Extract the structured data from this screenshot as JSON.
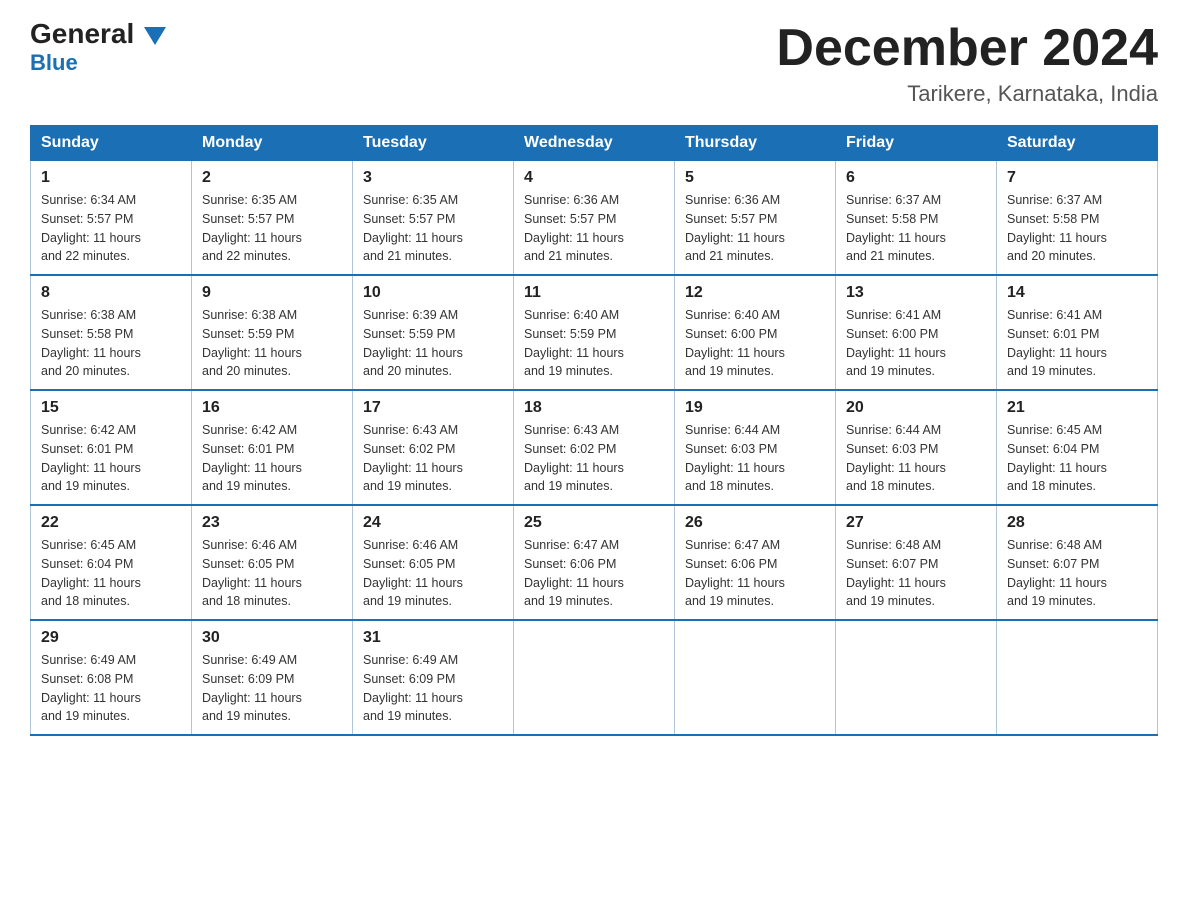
{
  "header": {
    "logo_general": "General",
    "logo_blue": "Blue",
    "month_title": "December 2024",
    "location": "Tarikere, Karnataka, India"
  },
  "days_of_week": [
    "Sunday",
    "Monday",
    "Tuesday",
    "Wednesday",
    "Thursday",
    "Friday",
    "Saturday"
  ],
  "weeks": [
    [
      {
        "day": "1",
        "sunrise": "6:34 AM",
        "sunset": "5:57 PM",
        "daylight": "11 hours and 22 minutes."
      },
      {
        "day": "2",
        "sunrise": "6:35 AM",
        "sunset": "5:57 PM",
        "daylight": "11 hours and 22 minutes."
      },
      {
        "day": "3",
        "sunrise": "6:35 AM",
        "sunset": "5:57 PM",
        "daylight": "11 hours and 21 minutes."
      },
      {
        "day": "4",
        "sunrise": "6:36 AM",
        "sunset": "5:57 PM",
        "daylight": "11 hours and 21 minutes."
      },
      {
        "day": "5",
        "sunrise": "6:36 AM",
        "sunset": "5:57 PM",
        "daylight": "11 hours and 21 minutes."
      },
      {
        "day": "6",
        "sunrise": "6:37 AM",
        "sunset": "5:58 PM",
        "daylight": "11 hours and 21 minutes."
      },
      {
        "day": "7",
        "sunrise": "6:37 AM",
        "sunset": "5:58 PM",
        "daylight": "11 hours and 20 minutes."
      }
    ],
    [
      {
        "day": "8",
        "sunrise": "6:38 AM",
        "sunset": "5:58 PM",
        "daylight": "11 hours and 20 minutes."
      },
      {
        "day": "9",
        "sunrise": "6:38 AM",
        "sunset": "5:59 PM",
        "daylight": "11 hours and 20 minutes."
      },
      {
        "day": "10",
        "sunrise": "6:39 AM",
        "sunset": "5:59 PM",
        "daylight": "11 hours and 20 minutes."
      },
      {
        "day": "11",
        "sunrise": "6:40 AM",
        "sunset": "5:59 PM",
        "daylight": "11 hours and 19 minutes."
      },
      {
        "day": "12",
        "sunrise": "6:40 AM",
        "sunset": "6:00 PM",
        "daylight": "11 hours and 19 minutes."
      },
      {
        "day": "13",
        "sunrise": "6:41 AM",
        "sunset": "6:00 PM",
        "daylight": "11 hours and 19 minutes."
      },
      {
        "day": "14",
        "sunrise": "6:41 AM",
        "sunset": "6:01 PM",
        "daylight": "11 hours and 19 minutes."
      }
    ],
    [
      {
        "day": "15",
        "sunrise": "6:42 AM",
        "sunset": "6:01 PM",
        "daylight": "11 hours and 19 minutes."
      },
      {
        "day": "16",
        "sunrise": "6:42 AM",
        "sunset": "6:01 PM",
        "daylight": "11 hours and 19 minutes."
      },
      {
        "day": "17",
        "sunrise": "6:43 AM",
        "sunset": "6:02 PM",
        "daylight": "11 hours and 19 minutes."
      },
      {
        "day": "18",
        "sunrise": "6:43 AM",
        "sunset": "6:02 PM",
        "daylight": "11 hours and 19 minutes."
      },
      {
        "day": "19",
        "sunrise": "6:44 AM",
        "sunset": "6:03 PM",
        "daylight": "11 hours and 18 minutes."
      },
      {
        "day": "20",
        "sunrise": "6:44 AM",
        "sunset": "6:03 PM",
        "daylight": "11 hours and 18 minutes."
      },
      {
        "day": "21",
        "sunrise": "6:45 AM",
        "sunset": "6:04 PM",
        "daylight": "11 hours and 18 minutes."
      }
    ],
    [
      {
        "day": "22",
        "sunrise": "6:45 AM",
        "sunset": "6:04 PM",
        "daylight": "11 hours and 18 minutes."
      },
      {
        "day": "23",
        "sunrise": "6:46 AM",
        "sunset": "6:05 PM",
        "daylight": "11 hours and 18 minutes."
      },
      {
        "day": "24",
        "sunrise": "6:46 AM",
        "sunset": "6:05 PM",
        "daylight": "11 hours and 19 minutes."
      },
      {
        "day": "25",
        "sunrise": "6:47 AM",
        "sunset": "6:06 PM",
        "daylight": "11 hours and 19 minutes."
      },
      {
        "day": "26",
        "sunrise": "6:47 AM",
        "sunset": "6:06 PM",
        "daylight": "11 hours and 19 minutes."
      },
      {
        "day": "27",
        "sunrise": "6:48 AM",
        "sunset": "6:07 PM",
        "daylight": "11 hours and 19 minutes."
      },
      {
        "day": "28",
        "sunrise": "6:48 AM",
        "sunset": "6:07 PM",
        "daylight": "11 hours and 19 minutes."
      }
    ],
    [
      {
        "day": "29",
        "sunrise": "6:49 AM",
        "sunset": "6:08 PM",
        "daylight": "11 hours and 19 minutes."
      },
      {
        "day": "30",
        "sunrise": "6:49 AM",
        "sunset": "6:09 PM",
        "daylight": "11 hours and 19 minutes."
      },
      {
        "day": "31",
        "sunrise": "6:49 AM",
        "sunset": "6:09 PM",
        "daylight": "11 hours and 19 minutes."
      },
      null,
      null,
      null,
      null
    ]
  ],
  "sunrise_label": "Sunrise:",
  "sunset_label": "Sunset:",
  "daylight_label": "Daylight:"
}
